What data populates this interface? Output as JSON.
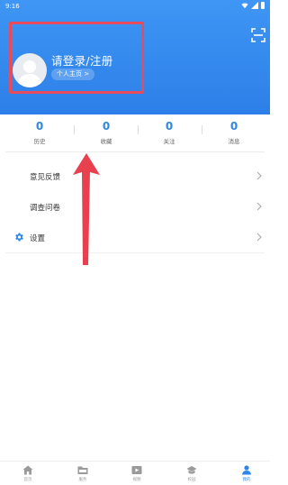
{
  "status_bar": {
    "time": "9:16"
  },
  "profile": {
    "login_text": "请登录/注册",
    "home_link": "个人主页 >"
  },
  "stats": [
    {
      "value": "0",
      "label": "历史"
    },
    {
      "value": "0",
      "label": "收藏"
    },
    {
      "value": "0",
      "label": "关注"
    },
    {
      "value": "0",
      "label": "消息"
    }
  ],
  "menu": [
    {
      "label": "意见反馈",
      "icon": "none"
    },
    {
      "label": "调查问卷",
      "icon": "none"
    },
    {
      "label": "设置",
      "icon": "gear-icon"
    }
  ],
  "tabs": [
    {
      "label": "首页",
      "icon": "home-icon",
      "active": false
    },
    {
      "label": "服务",
      "icon": "folder-icon",
      "active": false
    },
    {
      "label": "视频",
      "icon": "video-icon",
      "active": false
    },
    {
      "label": "校园",
      "icon": "graduation-cap-icon",
      "active": false
    },
    {
      "label": "我的",
      "icon": "person-icon",
      "active": true
    }
  ],
  "colors": {
    "header_blue": "#2f86ee",
    "accent_blue": "#2d86e8",
    "highlight_red": "#e84b5c"
  }
}
